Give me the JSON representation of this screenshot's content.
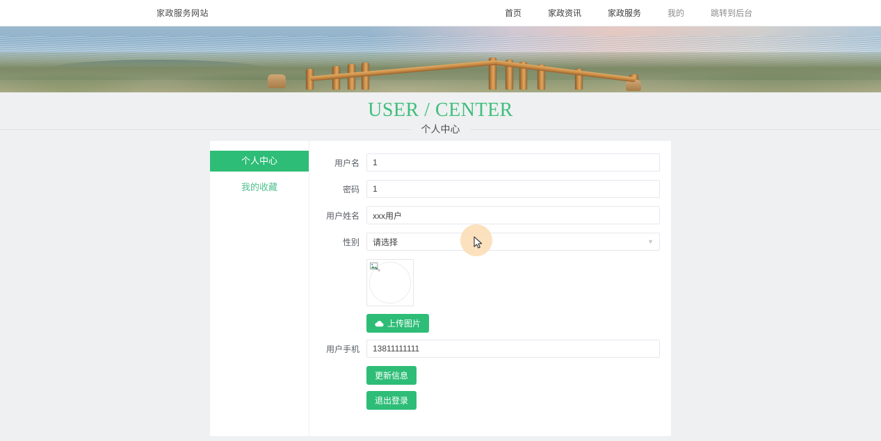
{
  "nav": {
    "brand": "家政服务网站",
    "items": [
      {
        "label": "首页",
        "muted": false
      },
      {
        "label": "家政资讯",
        "muted": false
      },
      {
        "label": "家政服务",
        "muted": false
      },
      {
        "label": "我的",
        "muted": true
      },
      {
        "label": "跳转到后台",
        "muted": true
      }
    ]
  },
  "banner": {
    "alt": "beach-fence-sunset-banner"
  },
  "header": {
    "title_en": "USER / CENTER",
    "title_cn": "个人中心"
  },
  "sidebar": {
    "items": [
      {
        "label": "个人中心",
        "active": true
      },
      {
        "label": "我的收藏",
        "active": false
      }
    ]
  },
  "form": {
    "fields": [
      {
        "label": "用户名",
        "value": "1",
        "placeholder": "",
        "type": "text"
      },
      {
        "label": "密码",
        "value": "1",
        "placeholder": "",
        "type": "text"
      },
      {
        "label": "用户姓名",
        "value": "xxx用户",
        "placeholder": "",
        "type": "text"
      },
      {
        "label": "性别",
        "value": "",
        "placeholder": "请选择",
        "type": "select"
      }
    ],
    "avatar": {
      "label": "user-avatar-preview",
      "broken": true
    },
    "upload_button": "上传图片",
    "phone": {
      "label": "用户手机",
      "value": "13811111111"
    },
    "update_button": "更新信息",
    "logout_button": "退出登录"
  },
  "colors": {
    "accent_green": "#2EBD77",
    "link_green": "#4fc08d",
    "title_green": "#3fbe7c",
    "page_bg": "#eef0f1",
    "card_bg": "#ffffff",
    "border": "#e4e7ed",
    "placeholder": "#c0c4cc",
    "cursor_halo": "#fbdcb3"
  }
}
